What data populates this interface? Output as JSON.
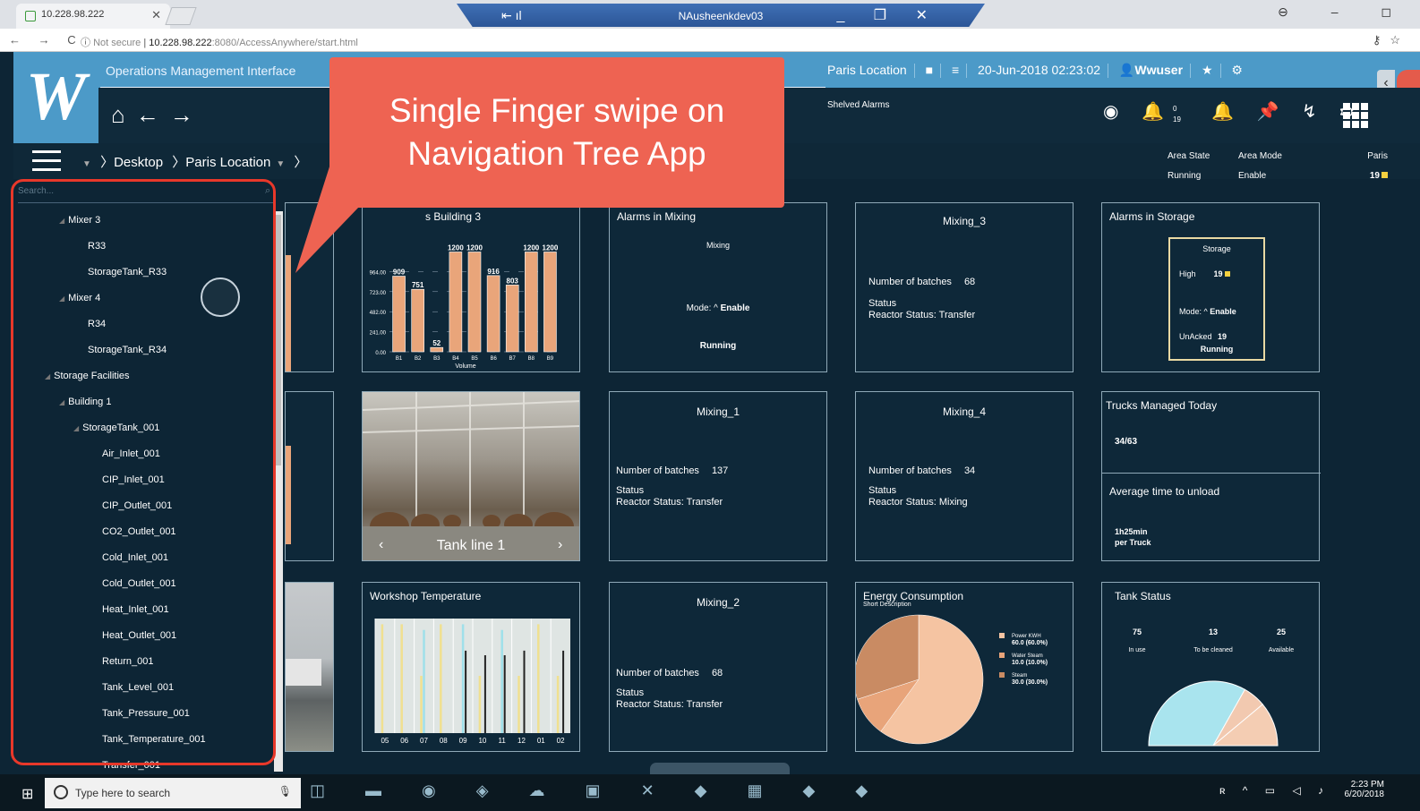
{
  "browser": {
    "tab_title": "10.228.98.222",
    "rdp_title": "NAusheenkdev03",
    "url_prefix": "Not secure",
    "url_host": "10.228.98.222",
    "url_rest": ":8080/AccessAnywhere/start.html"
  },
  "header": {
    "app_title": "Operations Management Interface",
    "location": "Paris Location",
    "datetime": "20-Jun-2018 02:23:02",
    "user": "Wwuser",
    "shelved": "Shelved Alarms",
    "alarm_top": "0",
    "alarm_bottom": "19"
  },
  "callout": {
    "line1": "Single Finger swipe on",
    "line2": "Navigation Tree App"
  },
  "breadcrumb": [
    "Desktop",
    "Paris Location"
  ],
  "area": {
    "state_label": "Area State",
    "state_value": "Running",
    "mode_label": "Area Mode",
    "mode_value": "Enable",
    "paris_label": "Paris",
    "paris_value": "19"
  },
  "tree": {
    "search_placeholder": "Search...",
    "items": [
      {
        "label": "Mixer 3",
        "expander": true
      },
      {
        "label": "R33"
      },
      {
        "label": "StorageTank_R33"
      },
      {
        "label": "Mixer 4",
        "expander": true
      },
      {
        "label": "R34"
      },
      {
        "label": "StorageTank_R34"
      },
      {
        "label": "Storage Facilities",
        "expander": true
      },
      {
        "label": "Building 1",
        "expander": true
      },
      {
        "label": "StorageTank_001",
        "expander": true
      },
      {
        "label": "Air_Inlet_001"
      },
      {
        "label": "CIP_Inlet_001"
      },
      {
        "label": "CIP_Outlet_001"
      },
      {
        "label": "CO2_Outlet_001"
      },
      {
        "label": "Cold_Inlet_001"
      },
      {
        "label": "Cold_Outlet_001"
      },
      {
        "label": "Heat_Inlet_001"
      },
      {
        "label": "Heat_Outlet_001"
      },
      {
        "label": "Return_001"
      },
      {
        "label": "Tank_Level_001"
      },
      {
        "label": "Tank_Pressure_001"
      },
      {
        "label": "Tank_Temperature_001"
      },
      {
        "label": "Transfer_001"
      }
    ]
  },
  "tiles": {
    "volumes": {
      "title_visible": "s Building 3",
      "xlabel": "Volume"
    },
    "alarms_mixing": {
      "title": "Alarms in Mixing",
      "area": "Mixing",
      "mode_label": "Mode:",
      "mode_value": "Enable",
      "state": "Running"
    },
    "mixing3": {
      "title": "Mixing_3",
      "batches_label": "Number of batches",
      "batches": "68",
      "status_label": "Status",
      "reactor": "Reactor Status: Transfer"
    },
    "alarms_storage": {
      "title": "Alarms in Storage",
      "area": "Storage",
      "high_label": "High",
      "high_value": "19",
      "mode_label": "Mode:",
      "mode_value": "Enable",
      "unacked_label": "UnAcked",
      "unacked_value": "19",
      "state": "Running"
    },
    "tankline": {
      "label": "Tank line 1"
    },
    "mixing1": {
      "title": "Mixing_1",
      "batches_label": "Number of batches",
      "batches": "137",
      "status_label": "Status",
      "reactor": "Reactor Status: Transfer"
    },
    "mixing4": {
      "title": "Mixing_4",
      "batches_label": "Number of batches",
      "batches": "34",
      "status_label": "Status",
      "reactor": "Reactor Status: Mixing"
    },
    "trucks": {
      "title": "Trucks Managed Today",
      "value": "34/63",
      "avg_title": "Average time to unload",
      "avg_value": "1h25min",
      "avg_unit": "per Truck"
    },
    "workshop": {
      "title": "Workshop Temperature"
    },
    "mixing2": {
      "title": "Mixing_2",
      "batches_label": "Number of batches",
      "batches": "68",
      "status_label": "Status",
      "reactor": "Reactor Status: Transfer"
    },
    "energy": {
      "title": "Energy Consumption",
      "subtitle": "Short Description"
    },
    "tank_status": {
      "title": "Tank Status",
      "items": [
        {
          "value": "75",
          "label": "In use"
        },
        {
          "value": "13",
          "label": "To be cleaned"
        },
        {
          "value": "25",
          "label": "Available"
        }
      ]
    }
  },
  "chart_data": [
    {
      "type": "bar",
      "title": "",
      "xlabel": "Volume",
      "categories": [
        "B1",
        "B2",
        "B3",
        "B4",
        "B5",
        "B6",
        "B7",
        "B8",
        "B9"
      ],
      "values": [
        909,
        751,
        52,
        1200,
        1200,
        916,
        803,
        1200,
        1200
      ],
      "value_labels": [
        "909",
        "751",
        "52",
        "1200",
        "1200",
        "916",
        "803",
        "1200",
        "1200"
      ],
      "yticks": [
        "0.00",
        "241.00",
        "482.00",
        "723.00",
        "964.00"
      ],
      "ylim": [
        0,
        1205
      ],
      "color": "#e9a57a"
    },
    {
      "type": "bar",
      "title": "Workshop Temperature",
      "categories": [
        "05",
        "06",
        "07",
        "08",
        "09",
        "10",
        "11",
        "12",
        "01",
        "02"
      ],
      "series": [
        {
          "values": [
            0.95,
            0.95,
            0.5,
            0.95,
            0.0,
            0.5,
            0.0,
            0.5,
            0.95,
            0.5
          ]
        },
        {
          "values": [
            0.0,
            0.0,
            0.9,
            0.0,
            0.95,
            0.0,
            0.9,
            0.0,
            0.0,
            0.0
          ]
        },
        {
          "values": [
            0.0,
            0.0,
            0.0,
            0.0,
            0.72,
            0.68,
            0.68,
            0.72,
            0.0,
            0.72
          ]
        }
      ],
      "colors": [
        "#f0e090",
        "#9fe0ea",
        "#222222"
      ]
    },
    {
      "type": "pie",
      "title": "Energy Consumption",
      "slices": [
        {
          "name": "Power KWH",
          "value": 60.0,
          "pct": "(60.0%)",
          "color": "#f5c4a2"
        },
        {
          "name": "Water Steam",
          "value": 10.0,
          "pct": "(10.0%)",
          "color": "#e8a47a"
        },
        {
          "name": "Steam",
          "value": 30.0,
          "pct": "(30.0%)",
          "color": "#c98b63"
        }
      ]
    },
    {
      "type": "pie",
      "title": "Tank Status",
      "slices": [
        {
          "name": "In use",
          "value": 75,
          "color": "#a9e4ee"
        },
        {
          "name": "To be cleaned",
          "value": 13,
          "color": "#f2c9b0"
        },
        {
          "name": "Available",
          "value": 25,
          "color": "#f4cdb3"
        }
      ]
    }
  ],
  "taskbar": {
    "search_placeholder": "Type here to search",
    "time": "2:23 PM",
    "date": "6/20/2018"
  },
  "colors": {
    "accent": "#4c9ac8",
    "callout": "#ee6352",
    "annotation": "#e8382a",
    "bar": "#e9a57a"
  }
}
